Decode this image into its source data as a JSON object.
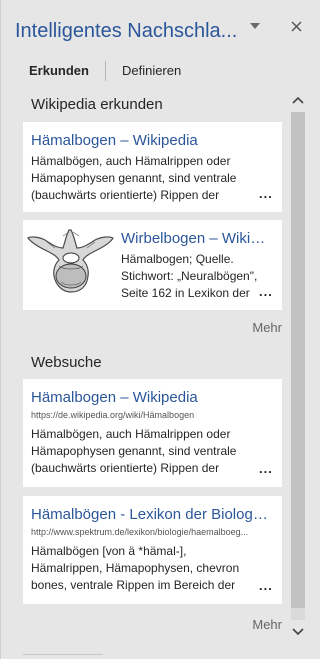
{
  "pane": {
    "title": "Intelligentes Nachschla...",
    "dropdown_icon": "chevron-down-icon",
    "close_icon": "close-icon"
  },
  "tabs": [
    {
      "label": "Erkunden",
      "active": true
    },
    {
      "label": "Definieren",
      "active": false
    }
  ],
  "wikipedia": {
    "section_title": "Wikipedia erkunden",
    "cards": [
      {
        "title": "Hämalbogen – Wikipedia",
        "snippet": "Hämalbögen, auch Hämalrippen oder Hämapophysen genannt, sind ventrale (bauchwärts orientierte) Rippen der",
        "more": "..."
      },
      {
        "title": "Wirbelbogen – Wikip...",
        "snippet": "Hämalbogen; Quelle. Stichwort: „Neuralbögen\", Seite 162 in Lexikon der",
        "more": "...",
        "thumbnail": "vertebra-illustration"
      }
    ],
    "more_label": "Mehr"
  },
  "websearch": {
    "section_title": "Websuche",
    "cards": [
      {
        "title": "Hämalbogen – Wikipedia",
        "url": "https://de.wikipedia.org/wiki/Hämalbogen",
        "snippet": "Hämalbögen, auch Hämalrippen oder Hämapophysen genannt, sind ventrale (bauchwärts orientierte) Rippen der",
        "more": "..."
      },
      {
        "title": "Hämalbögen - Lexikon der Biologie...",
        "url": "http://www.spektrum.de/lexikon/biologie/haemalboeg...",
        "snippet": "Hämalbögen [von ä *hämal-], Hämalrippen, Hämapophysen, chevron bones, ventrale Rippen im Bereich der",
        "more": "..."
      }
    ],
    "more_label": "Mehr"
  },
  "scrollbar": {
    "up_icon": "chevron-up-icon",
    "down_icon": "chevron-down-icon"
  }
}
